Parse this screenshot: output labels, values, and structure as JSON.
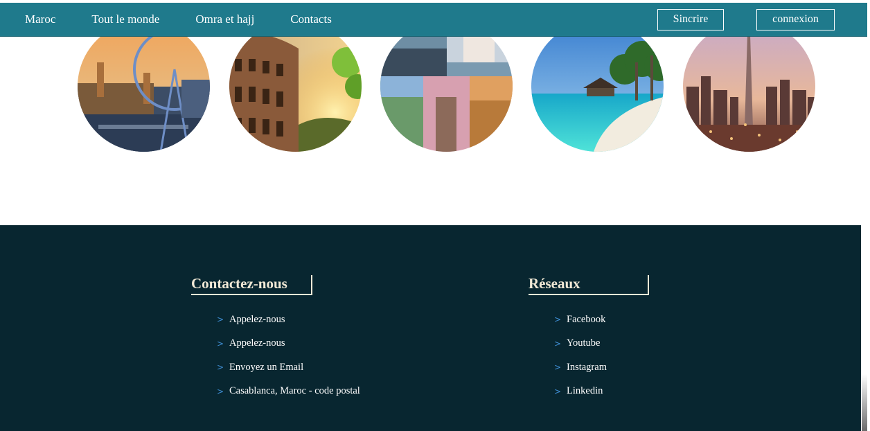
{
  "nav": {
    "links": [
      "Maroc",
      "Tout le monde",
      "Omra et hajj",
      "Contacts"
    ],
    "signup_label": "Sincrire",
    "login_label": "connexion"
  },
  "gallery": {
    "destinations": [
      "london-icon",
      "colosseum-icon",
      "world-wonders-icon",
      "maldives-beach-icon",
      "dubai-icon"
    ]
  },
  "footer": {
    "contact": {
      "title": "Contactez-nous",
      "items": [
        "Appelez-nous",
        "Appelez-nous",
        "Envoyez un Email",
        "Casablanca, Maroc - code postal"
      ]
    },
    "social": {
      "title": "Réseaux",
      "items": [
        "Facebook",
        "Youtube",
        "Instagram",
        "Linkedin"
      ]
    },
    "bullet": ">"
  },
  "colors": {
    "nav_bg": "#1f7a8c",
    "footer_bg": "#082630",
    "heading": "#f1e9d6",
    "bullet": "#3f8fd6"
  }
}
